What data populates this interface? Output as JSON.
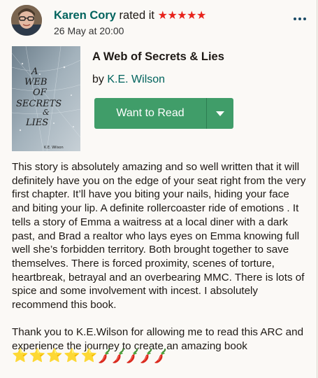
{
  "header": {
    "user_name": "Karen Cory",
    "rated_text": "rated it",
    "rating_stars": "★★★★★",
    "date": "26 May at 20:00"
  },
  "book": {
    "title": "A Web of Secrets & Lies",
    "by_label": "by",
    "author": "K.E. Wilson",
    "cover_title_text": "A WEB OF SECRETS & LIES",
    "cover_author": "K.E. Wilson",
    "want_to_read_label": "Want to Read"
  },
  "review": {
    "paragraph1": "This story is absolutely amazing and so well written that it will definitely have you on the edge of your seat right from the very first chapter. It’ll have you biting your nails, hiding your face and biting your lip. A definite rollercoaster ride of emotions . It tells a story of Emma a waitress at a local diner with a dark past, and Brad a realtor who lays eyes on Emma knowing full well she’s forbidden territory. Both brought together to save themselves. There is forced proximity, scenes of torture, heartbreak, betrayal and an overbearing MMC. There is lots of spice and some involvement with incest. I absolutely recommend this book.",
    "paragraph2": "Thank you to K.E.Wilson for allowing me to read this ARC and experience the journey to create an amazing book",
    "emoji_stars": [
      "⭐",
      "⭐",
      "⭐",
      "⭐",
      "⭐"
    ],
    "emoji_peppers": [
      "🌶️",
      "🌶️",
      "🌶️",
      "🌶️",
      "🌶️"
    ]
  },
  "colors": {
    "brand_green": "#00635d",
    "button_green": "#409d69",
    "rating_red": "#e8231c"
  },
  "icons": [
    "more-options-icon",
    "dropdown-caret-icon"
  ]
}
